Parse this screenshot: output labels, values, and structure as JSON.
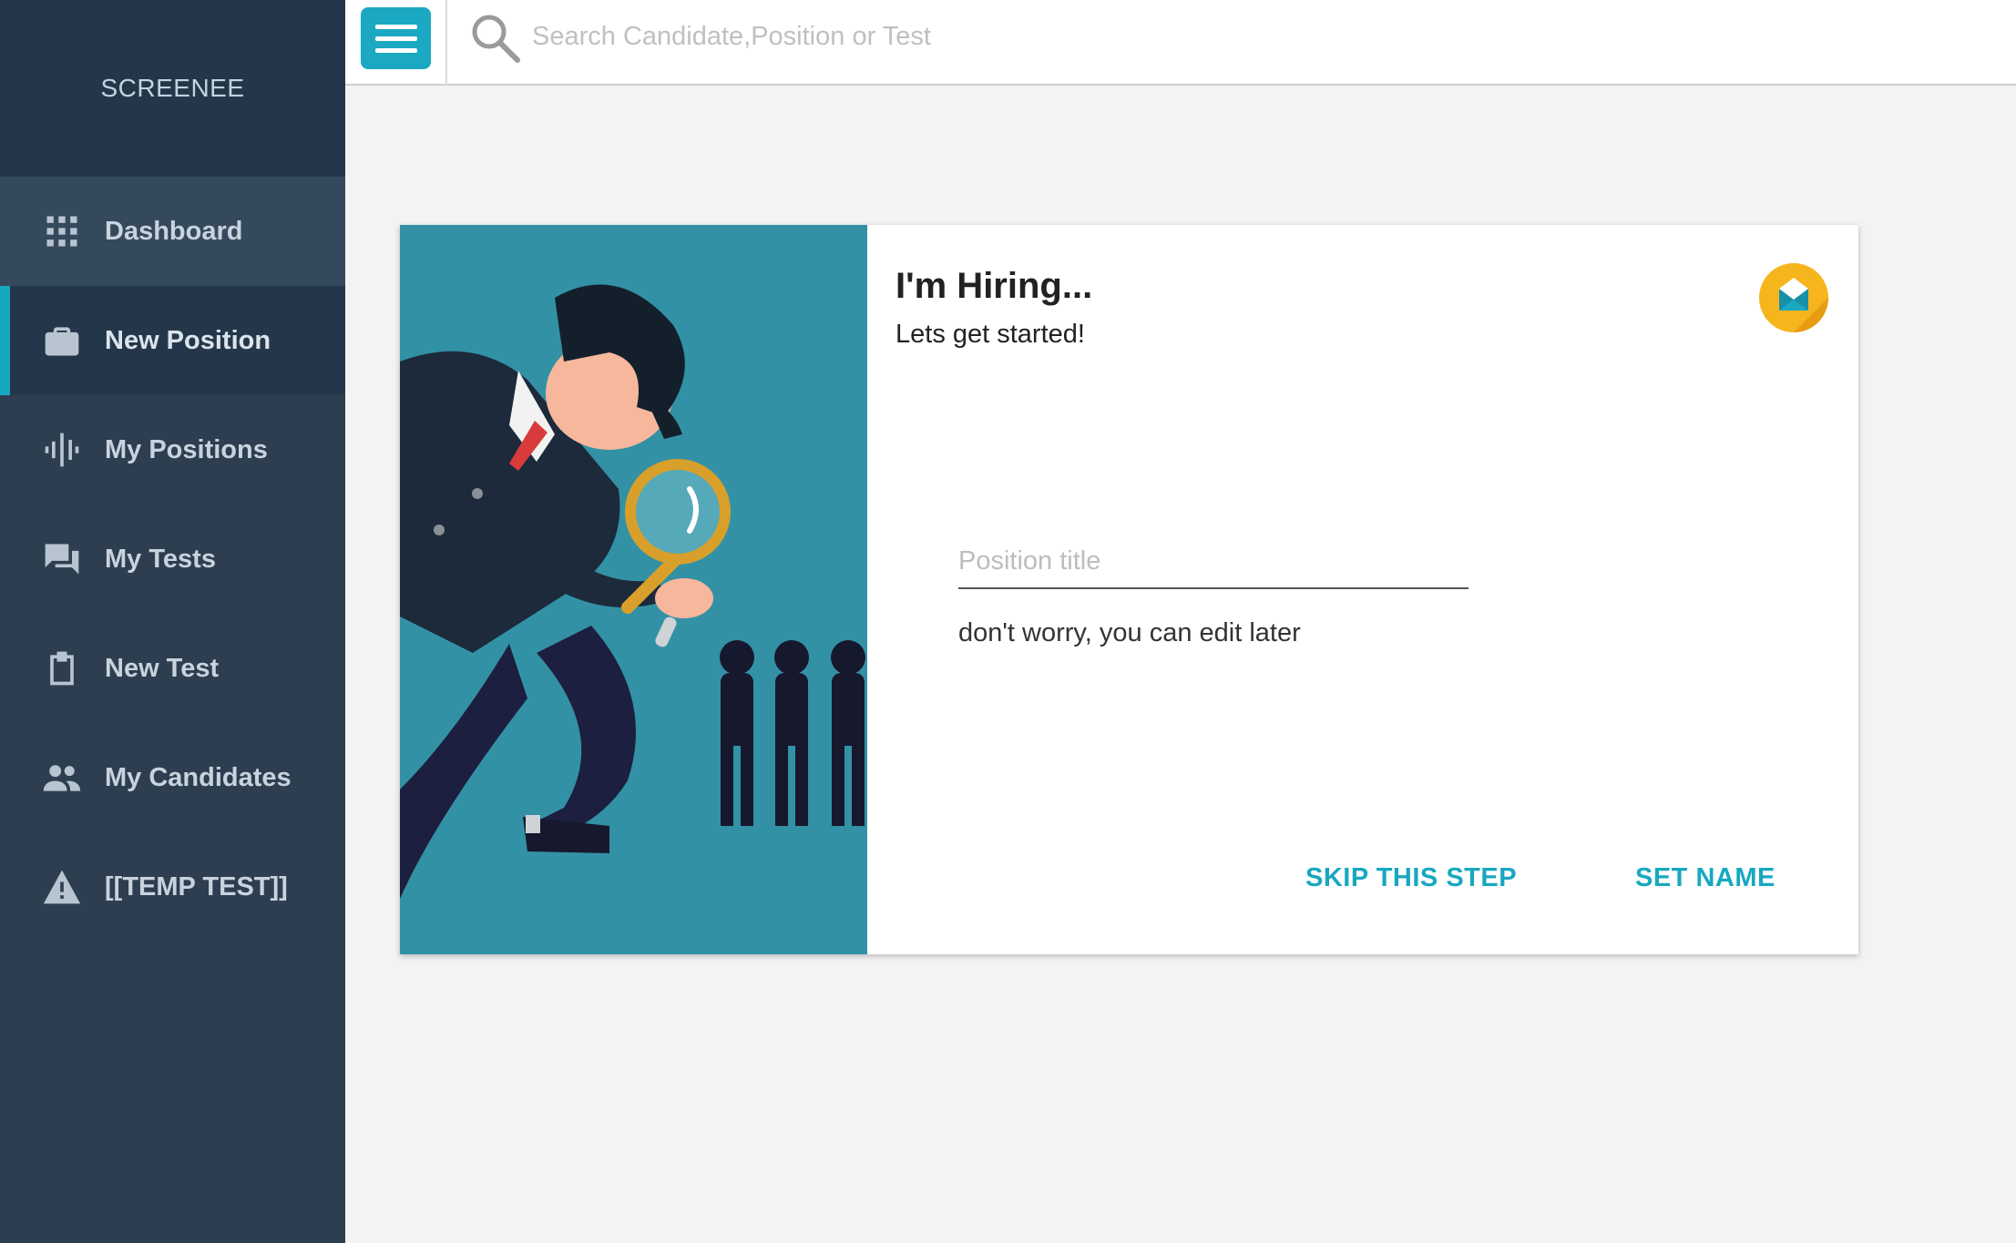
{
  "app": {
    "brand": "SCREENEE"
  },
  "sidebar": {
    "items": [
      {
        "label": "Dashboard",
        "icon": "grid-icon"
      },
      {
        "label": "New Position",
        "icon": "briefcase-icon",
        "active": true
      },
      {
        "label": "My Positions",
        "icon": "waveform-icon"
      },
      {
        "label": "My Tests",
        "icon": "chat-bubbles-icon"
      },
      {
        "label": "New Test",
        "icon": "clipboard-icon"
      },
      {
        "label": "My Candidates",
        "icon": "people-icon"
      },
      {
        "label": "[[TEMP TEST]]",
        "icon": "warning-icon"
      }
    ]
  },
  "topbar": {
    "search_placeholder": "Search Candidate,Position or Test"
  },
  "card": {
    "title": "I'm Hiring...",
    "subtitle": "Lets get started!",
    "field_placeholder": "Position title",
    "field_value": "",
    "hint": "don't worry, you can edit later",
    "skip_label": "SKIP THIS STEP",
    "set_label": "SET NAME"
  },
  "colors": {
    "accent": "#17a8c0",
    "sidebar_bg": "#2c3e50",
    "illustration_bg": "#3391a5",
    "badge_bg": "#f6b51d"
  }
}
